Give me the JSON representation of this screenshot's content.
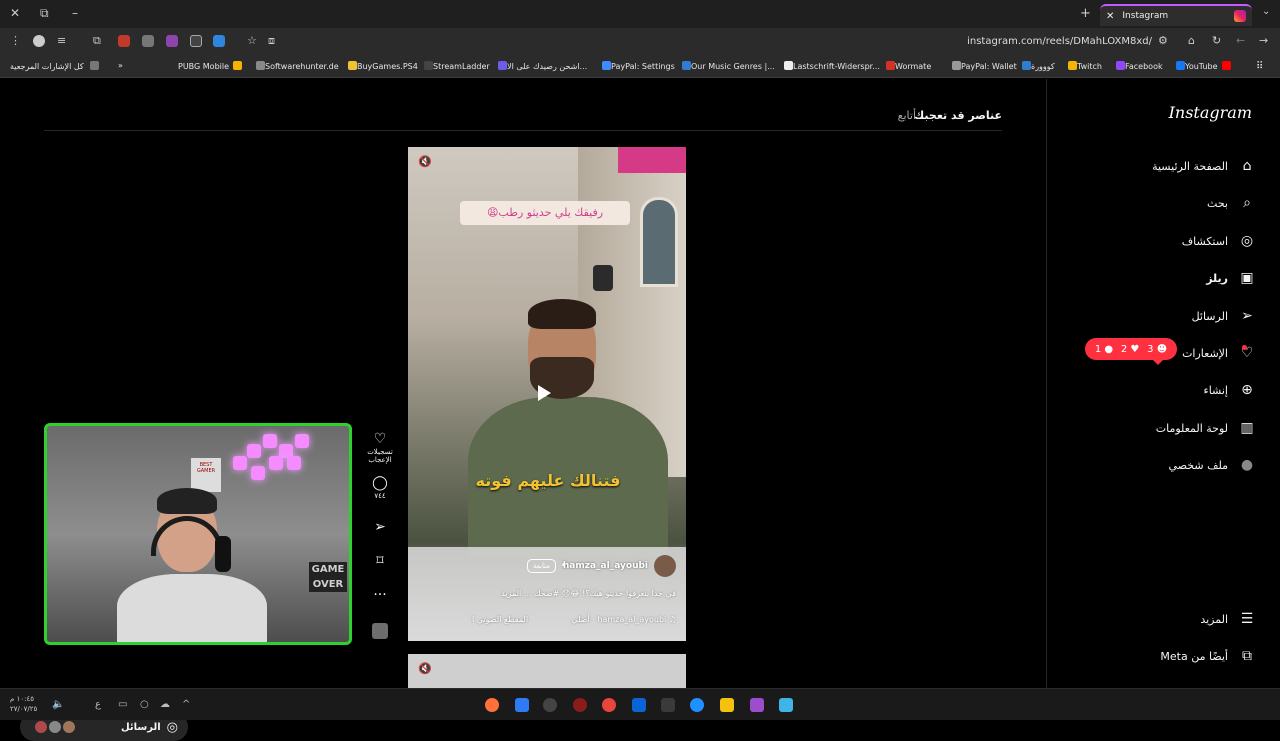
{
  "browser": {
    "tab_title": "Instagram",
    "url": "instagram.com/reels/DMahLOXM8xd/",
    "bookmarks": [
      {
        "label": "كل الإشارات المرجعية",
        "color": "#bbbbbb"
      },
      {
        "label": "PUBG Mobile",
        "color": "#f4b400"
      },
      {
        "label": "Softwarehunter.de",
        "color": "#888888"
      },
      {
        "label": "BuyGames.PS4",
        "color": "#f2c230"
      },
      {
        "label": "StreamLadder",
        "color": "#6c5ce7"
      },
      {
        "label": "اشحن رصيدك على الا...",
        "color": "#3d8bfd"
      },
      {
        "label": "PayPal: Settings",
        "color": "#2e7dd1"
      },
      {
        "label": "Our Music Genres |...",
        "color": "#eeeeee"
      },
      {
        "label": "Lastschrift-Widerspr...",
        "color": "#d93025"
      },
      {
        "label": "Wormate",
        "color": "#999999"
      },
      {
        "label": "PayPal: Wallet",
        "color": "#2e7dd1"
      },
      {
        "label": "كووورة",
        "color": "#f4b400"
      },
      {
        "label": "Twitch",
        "color": "#9146ff"
      },
      {
        "label": "Facebook",
        "color": "#1877f2"
      },
      {
        "label": "YouTube",
        "color": "#ff0000"
      }
    ]
  },
  "sidebar": {
    "logo": "Instagram",
    "items": [
      {
        "label": "الصفحة الرئيسية",
        "icon": "home-icon",
        "glyph": "⌂"
      },
      {
        "label": "بحث",
        "icon": "search-icon",
        "glyph": "⌕"
      },
      {
        "label": "استكشاف",
        "icon": "compass-icon",
        "glyph": "◎"
      },
      {
        "label": "ريلز",
        "icon": "reels-icon",
        "glyph": "▣"
      },
      {
        "label": "الرسائل",
        "icon": "send-icon",
        "glyph": "➢"
      },
      {
        "label": "الإشعارات",
        "icon": "heart-icon",
        "glyph": "♡"
      },
      {
        "label": "إنشاء",
        "icon": "plus-icon",
        "glyph": "⊕"
      },
      {
        "label": "لوحة المعلومات",
        "icon": "dashboard-icon",
        "glyph": "▥"
      },
      {
        "label": "ملف شخصي",
        "icon": "avatar-icon",
        "glyph": "●"
      }
    ],
    "more": "المزيد",
    "meta": "أيضًا من Meta",
    "notifications": {
      "followers": "3",
      "likes": "2",
      "comments": "1"
    }
  },
  "suggestions": {
    "title": "عناصر قد تعجبك",
    "follow_tab": "أتابع"
  },
  "reel": {
    "caption_top": "رفيقك يلي حديثو رطب😩",
    "caption_bottom": "فتنالك عليهم فوته",
    "author": "hamza_al_ayoubi",
    "follow": "متابعة",
    "description": "في حدا بتعرفوا حديثو هيك؟! 😂😞 #ضحك ... المزيد",
    "audio_author": "hamza_al_ayoubi · أصلي",
    "audio_label": "المقطع الصوتي ا"
  },
  "actions": {
    "likes_label": "تسجيلات الإعجاب",
    "comments_count": "٧٤٤"
  },
  "messages": {
    "label": "الرسائل"
  },
  "taskbar": {
    "time": "١٠:٤٥ م",
    "date": "٢٧/٠٧/٢٥"
  },
  "webcam": {
    "poster_text": "BEST GAMER",
    "game_text": "GAME OVER"
  }
}
